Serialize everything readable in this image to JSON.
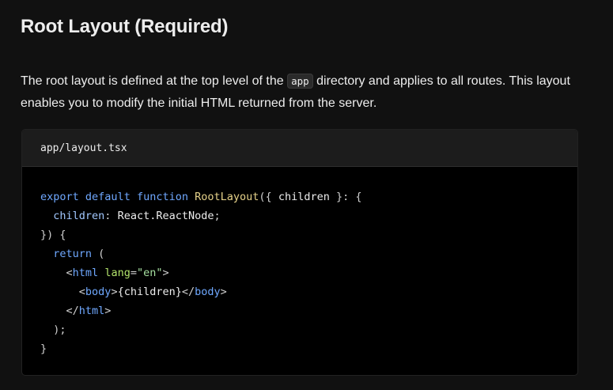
{
  "page": {
    "heading": "Root Layout (Required)",
    "paragraph": {
      "before": "The root layout is defined at the top level of the ",
      "code": "app",
      "after": " directory and applies to all routes. This layout enables you to modify the initial HTML returned from the server."
    }
  },
  "code_block": {
    "filename": "app/layout.tsx",
    "lines": [
      [
        {
          "t": "export",
          "c": "kw"
        },
        {
          "t": " ",
          "c": "plain"
        },
        {
          "t": "default",
          "c": "kw"
        },
        {
          "t": " ",
          "c": "plain"
        },
        {
          "t": "function",
          "c": "kw"
        },
        {
          "t": " ",
          "c": "plain"
        },
        {
          "t": "RootLayout",
          "c": "fn"
        },
        {
          "t": "({ ",
          "c": "punc"
        },
        {
          "t": "children",
          "c": "plain"
        },
        {
          "t": " }: {",
          "c": "punc"
        }
      ],
      [
        {
          "t": "  ",
          "c": "plain"
        },
        {
          "t": "children",
          "c": "prop"
        },
        {
          "t": ": ",
          "c": "punc"
        },
        {
          "t": "React.ReactNode",
          "c": "plain"
        },
        {
          "t": ";",
          "c": "punc"
        }
      ],
      [
        {
          "t": "}) {",
          "c": "punc"
        }
      ],
      [
        {
          "t": "  ",
          "c": "plain"
        },
        {
          "t": "return",
          "c": "kw"
        },
        {
          "t": " (",
          "c": "punc"
        }
      ],
      [
        {
          "t": "    ",
          "c": "plain"
        },
        {
          "t": "<",
          "c": "punc"
        },
        {
          "t": "html",
          "c": "tag"
        },
        {
          "t": " ",
          "c": "plain"
        },
        {
          "t": "lang",
          "c": "attr"
        },
        {
          "t": "=",
          "c": "punc"
        },
        {
          "t": "\"en\"",
          "c": "str"
        },
        {
          "t": ">",
          "c": "punc"
        }
      ],
      [
        {
          "t": "      ",
          "c": "plain"
        },
        {
          "t": "<",
          "c": "punc"
        },
        {
          "t": "body",
          "c": "tag"
        },
        {
          "t": ">",
          "c": "punc"
        },
        {
          "t": "{children}",
          "c": "plain"
        },
        {
          "t": "</",
          "c": "punc"
        },
        {
          "t": "body",
          "c": "tag"
        },
        {
          "t": ">",
          "c": "punc"
        }
      ],
      [
        {
          "t": "    ",
          "c": "plain"
        },
        {
          "t": "</",
          "c": "punc"
        },
        {
          "t": "html",
          "c": "tag"
        },
        {
          "t": ">",
          "c": "punc"
        }
      ],
      [
        {
          "t": "  );",
          "c": "punc"
        }
      ],
      [
        {
          "t": "}",
          "c": "punc"
        }
      ]
    ]
  },
  "colors": {
    "background": "#111111",
    "code_background": "#000000",
    "header_background": "#1c1c1c",
    "keyword": "#6fa8ff",
    "function_name": "#e6d28a",
    "attribute": "#b2e26b"
  }
}
